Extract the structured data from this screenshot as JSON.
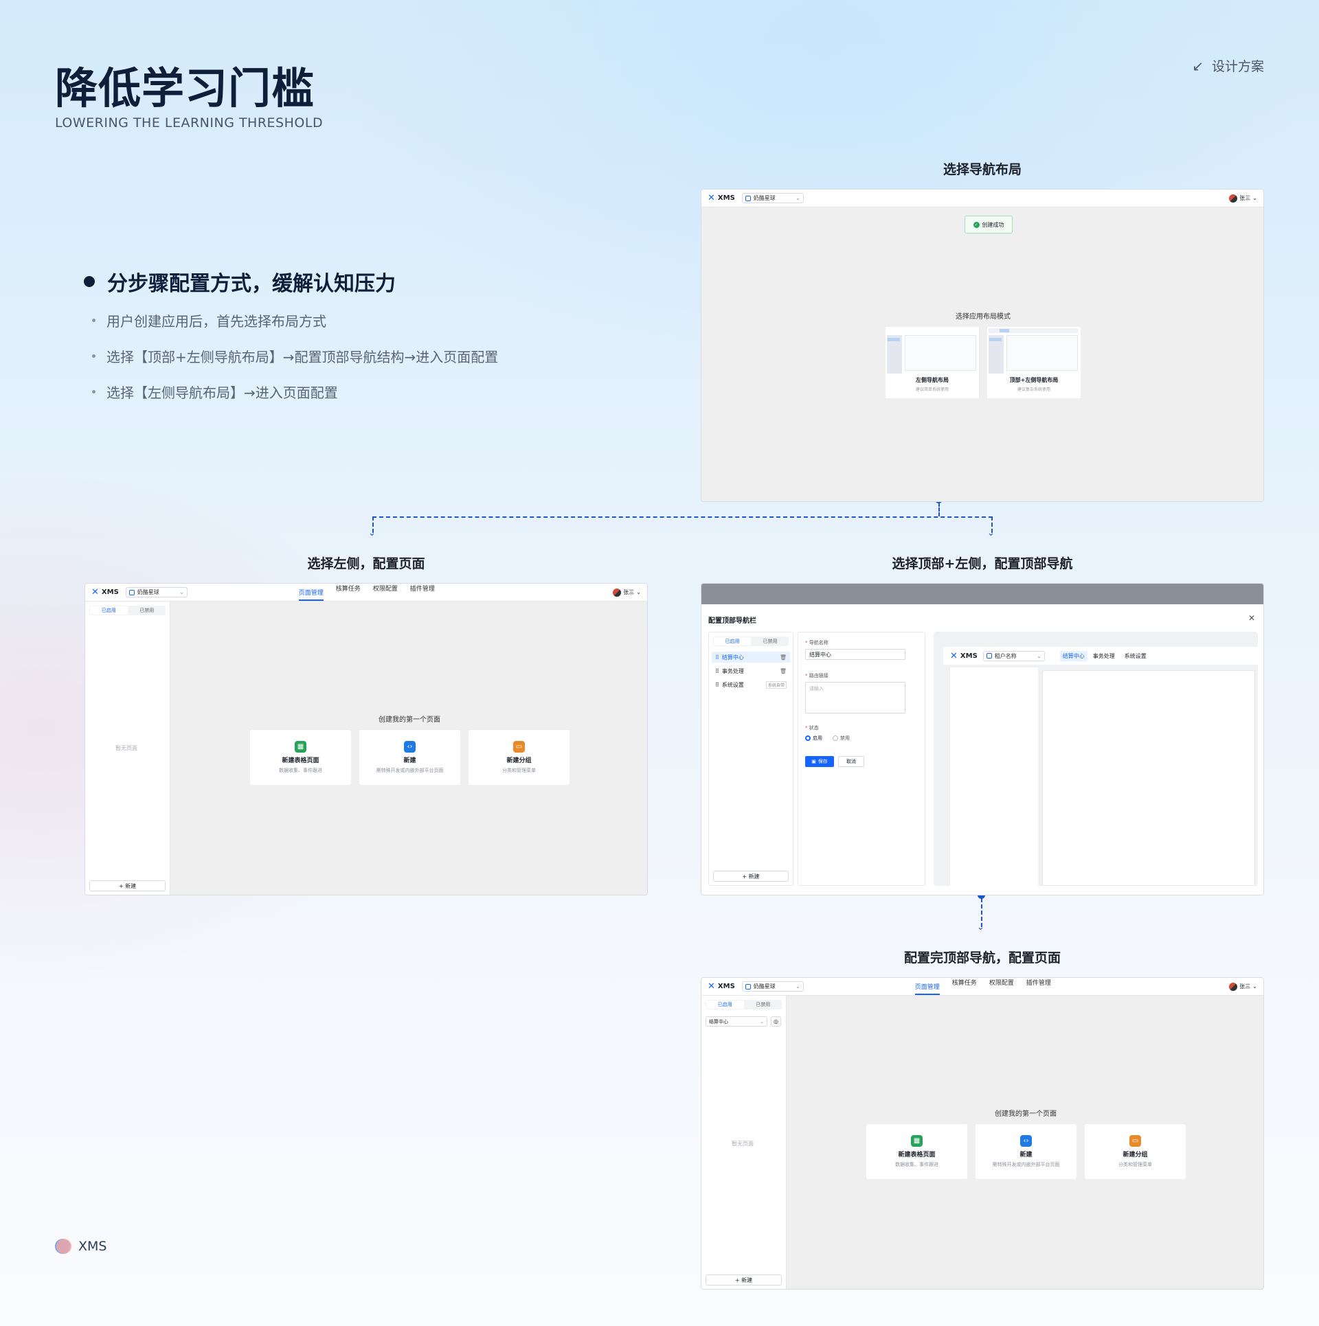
{
  "page": {
    "title": "降低学习门槛",
    "subtitle": "LOWERING THE LEARNING THRESHOLD",
    "top_right": "设计方案",
    "brand": "XMS"
  },
  "points": {
    "main": "分步骤配置方式，缓解认知压力",
    "items": [
      "用户创建应用后，首先选择布局方式",
      "选择【顶部+左侧导航布局】→配置顶部导航结构→进入页面配置",
      "选择【左侧导航布局】→进入页面配置"
    ]
  },
  "sections": {
    "layout": "选择导航布局",
    "left": "选择左侧，配置页面",
    "top_left": "选择顶部+左侧，配置顶部导航",
    "done": "配置完顶部导航，配置页面"
  },
  "app": {
    "logo": "XMS",
    "tenant": "奶酪星球",
    "user": "张三",
    "nav": [
      "页面管理",
      "核算任务",
      "权限配置",
      "插件管理"
    ],
    "seg": [
      "已启用",
      "已禁用"
    ],
    "new": "+ 新建",
    "empty": "暂无页面",
    "first_page": "创建我的第一个页面",
    "cards": [
      {
        "title": "新建表格页面",
        "desc": "数据收集、事件跟进",
        "icon": "table-icon",
        "color": "#27a25a"
      },
      {
        "title": "新建",
        "desc": "需特殊开发或内嵌外部平台页面",
        "icon": "code-icon",
        "color": "#1e7be6"
      },
      {
        "title": "新建分组",
        "desc": "分类和管理菜单",
        "icon": "folder-icon",
        "color": "#e8892a"
      }
    ]
  },
  "layout_screen": {
    "toast": "创建成功",
    "heading": "选择应用布局模式",
    "options": [
      {
        "title": "左侧导航布局",
        "desc": "建议简单系统使用"
      },
      {
        "title": "顶部+左侧导航布局",
        "desc": "建议复杂系统使用"
      }
    ]
  },
  "topnav_config": {
    "title": "配置顶部导航栏",
    "items": [
      {
        "label": "结算中心",
        "active": true
      },
      {
        "label": "事务处理"
      },
      {
        "label": "系统设置",
        "tag": "系统自带"
      }
    ],
    "name_label": "导航名称",
    "name_value": "结算中心",
    "route_label": "路由链接",
    "route_placeholder": "请输入",
    "status_label": "状态",
    "status_on": "启用",
    "status_off": "禁用",
    "save": "保存",
    "cancel": "取消",
    "preview": {
      "tenant": "租户名称",
      "nav": [
        "结算中心",
        "事务处理",
        "系统设置"
      ]
    }
  },
  "done_screen": {
    "dropdown": "结算中心"
  }
}
